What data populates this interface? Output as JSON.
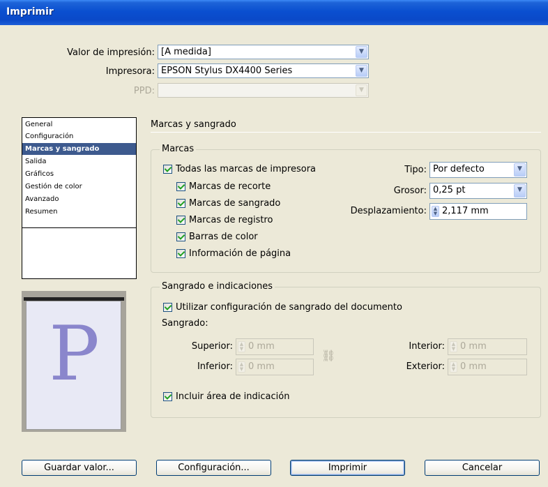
{
  "window": {
    "title": "Imprimir"
  },
  "top": {
    "preset_label": "Valor de impresión:",
    "preset_value": "[A medida]",
    "printer_label": "Impresora:",
    "printer_value": "EPSON Stylus DX4400 Series",
    "ppd_label": "PPD:",
    "ppd_value": ""
  },
  "nav": {
    "items": [
      {
        "label": "General",
        "selected": false
      },
      {
        "label": "Configuración",
        "selected": false
      },
      {
        "label": "Marcas y sangrado",
        "selected": true
      },
      {
        "label": "Salida",
        "selected": false
      },
      {
        "label": "Gráficos",
        "selected": false
      },
      {
        "label": "Gestión de color",
        "selected": false
      },
      {
        "label": "Avanzado",
        "selected": false
      },
      {
        "label": "Resumen",
        "selected": false
      }
    ]
  },
  "preview": {
    "letter": "P"
  },
  "section": {
    "title": "Marcas y sangrado"
  },
  "marks": {
    "group_title": "Marcas",
    "all_marks": {
      "label": "Todas las marcas de impresora",
      "checked": true
    },
    "items": [
      {
        "label": "Marcas de recorte",
        "checked": true
      },
      {
        "label": "Marcas de sangrado",
        "checked": true
      },
      {
        "label": "Marcas de registro",
        "checked": true
      },
      {
        "label": "Barras de color",
        "checked": true
      },
      {
        "label": "Información de página",
        "checked": true
      }
    ],
    "type_label": "Tipo:",
    "type_value": "Por defecto",
    "weight_label": "Grosor:",
    "weight_value": "0,25 pt",
    "offset_label": "Desplazamiento:",
    "offset_value": "2,117 mm"
  },
  "bleed": {
    "group_title": "Sangrado e indicaciones",
    "use_doc": {
      "label": "Utilizar configuración de sangrado del documento",
      "checked": true
    },
    "bleed_label": "Sangrado:",
    "top_label": "Superior:",
    "top_value": "0 mm",
    "bottom_label": "Inferior:",
    "bottom_value": "0 mm",
    "inside_label": "Interior:",
    "inside_value": "0 mm",
    "outside_label": "Exterior:",
    "outside_value": "0 mm",
    "slug": {
      "label": "Incluir área de indicación",
      "checked": true
    }
  },
  "buttons": {
    "save_preset": "Guardar valor...",
    "setup": "Configuración...",
    "print": "Imprimir",
    "cancel": "Cancelar"
  },
  "icons": {
    "dropdown": "chevron-down-icon",
    "spinner": "spinner-arrows-icon",
    "link": "chain-link-icon",
    "check": "checkmark-icon"
  }
}
